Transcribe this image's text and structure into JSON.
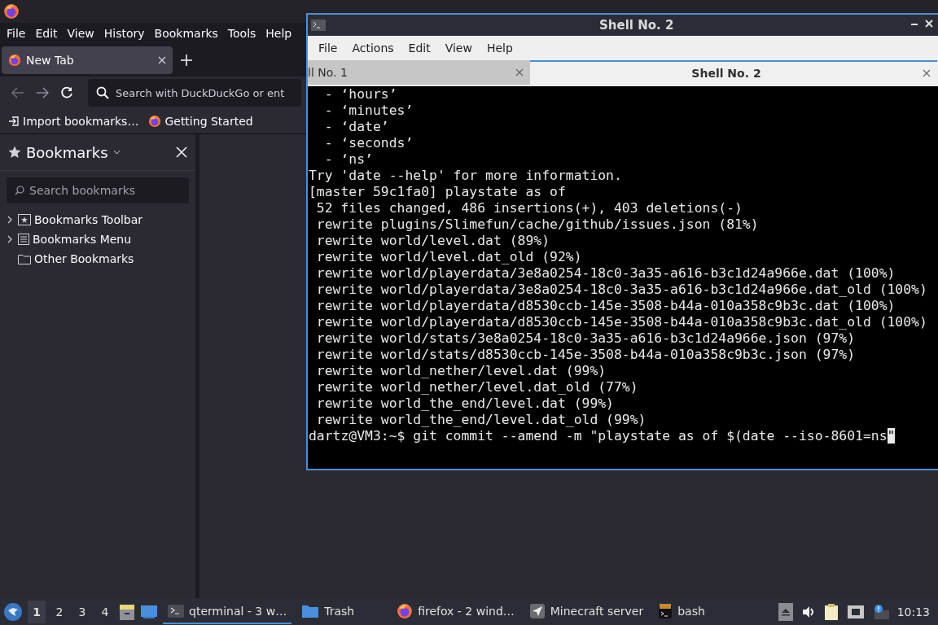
{
  "firefox": {
    "menu": [
      "File",
      "Edit",
      "View",
      "History",
      "Bookmarks",
      "Tools",
      "Help"
    ],
    "tabs": [
      {
        "label": "New Tab",
        "selected": true
      }
    ],
    "search": {
      "placeholder": "Search with DuckDuckGo or ent"
    },
    "bookmarks_bar": [
      {
        "kind": "import",
        "label": "Import bookmarks…"
      },
      {
        "kind": "firefox",
        "label": "Getting Started"
      }
    ],
    "sidebar": {
      "title": "Bookmarks",
      "search": {
        "placeholder": "Search bookmarks"
      },
      "items": [
        {
          "kind": "toolbar",
          "label": "Bookmarks Toolbar",
          "expandable": true
        },
        {
          "kind": "menu",
          "label": "Bookmarks Menu",
          "expandable": true
        },
        {
          "kind": "folder",
          "label": "Other Bookmarks",
          "expandable": false
        }
      ]
    }
  },
  "terminal": {
    "title": "Shell No. 2",
    "menu": [
      "File",
      "Actions",
      "Edit",
      "View",
      "Help"
    ],
    "tabs": [
      {
        "label": "ll No. 1",
        "selected": false
      },
      {
        "label": "Shell No. 2",
        "selected": true
      }
    ],
    "lines": [
      "  - ‘hours’",
      "  - ‘minutes’",
      "  - ‘date’",
      "  - ‘seconds’",
      "  - ‘ns’",
      "Try 'date --help' for more information.",
      "[master 59c1fa0] playstate as of",
      " 52 files changed, 486 insertions(+), 403 deletions(-)",
      " rewrite plugins/Slimefun/cache/github/issues.json (81%)",
      " rewrite world/level.dat (89%)",
      " rewrite world/level.dat_old (92%)",
      " rewrite world/playerdata/3e8a0254-18c0-3a35-a616-b3c1d24a966e.dat (100%)",
      " rewrite world/playerdata/3e8a0254-18c0-3a35-a616-b3c1d24a966e.dat_old (100%)",
      " rewrite world/playerdata/d8530ccb-145e-3508-b44a-010a358c9b3c.dat (100%)",
      " rewrite world/playerdata/d8530ccb-145e-3508-b44a-010a358c9b3c.dat_old (100%)",
      " rewrite world/stats/3e8a0254-18c0-3a35-a616-b3c1d24a966e.json (97%)",
      " rewrite world/stats/d8530ccb-145e-3508-b44a-010a358c9b3c.json (97%)",
      " rewrite world_nether/level.dat (99%)",
      " rewrite world_nether/level.dat_old (77%)",
      " rewrite world_the_end/level.dat (99%)",
      " rewrite world_the_end/level.dat_old (99%)"
    ],
    "prompt": "dartz@VM3:~$ git commit --amend -m \"playstate as of $(date --iso-8601=ns",
    "cursor_char": "\""
  },
  "taskbar": {
    "desktops": [
      {
        "label": "1",
        "selected": true
      },
      {
        "label": "2",
        "selected": false
      },
      {
        "label": "3",
        "selected": false
      },
      {
        "label": "4",
        "selected": false
      }
    ],
    "tasks": [
      {
        "kind": "terminal",
        "label": "qterminal - 3 w…",
        "selected": true
      },
      {
        "kind": "folder",
        "label": "Trash",
        "selected": false
      },
      {
        "kind": "firefox",
        "label": "firefox - 2 wind…",
        "selected": false
      },
      {
        "kind": "plane",
        "label": "Minecraft server",
        "selected": false
      },
      {
        "kind": "bash",
        "label": "bash",
        "selected": false
      }
    ],
    "clock": "10:13"
  }
}
